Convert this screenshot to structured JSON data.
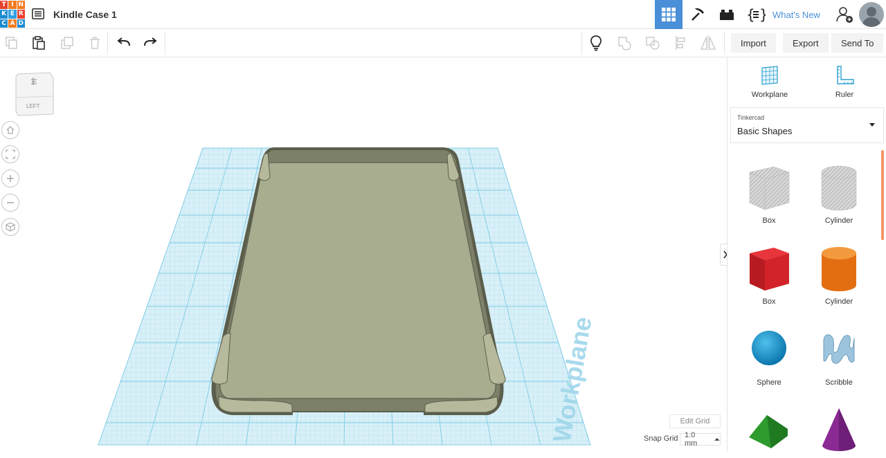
{
  "app": {
    "logo_letters": [
      "T",
      "I",
      "N",
      "K",
      "E",
      "R",
      "C",
      "A",
      "D"
    ],
    "logo_colors": [
      "#e8422f",
      "#f37b21",
      "#f37b21",
      "#1d8bd1",
      "#2f9fe0",
      "#e8422f",
      "#1d8bd1",
      "#f37b21",
      "#1d8bd1"
    ],
    "document_title": "Kindle Case 1",
    "whats_new": "What's New"
  },
  "toolbar": {
    "import_label": "Import",
    "export_label": "Export",
    "send_to_label": "Send To"
  },
  "viewport": {
    "viewcube_face": "LEFT",
    "workplane_text": "Workplane",
    "edit_grid": "Edit Grid",
    "snap_grid_label": "Snap Grid",
    "snap_grid_value": "1.0 mm",
    "grid_color": "#7ecbe6",
    "model_color": "#a9ad8f"
  },
  "panel": {
    "workplane_label": "Workplane",
    "ruler_label": "Ruler",
    "library_source": "Tinkercad",
    "library_name": "Basic Shapes",
    "shapes": [
      {
        "label": "Box",
        "icon": "box-hole-icon"
      },
      {
        "label": "Cylinder",
        "icon": "cylinder-hole-icon"
      },
      {
        "label": "Box",
        "icon": "box-icon"
      },
      {
        "label": "Cylinder",
        "icon": "cylinder-icon"
      },
      {
        "label": "Sphere",
        "icon": "sphere-icon"
      },
      {
        "label": "Scribble",
        "icon": "scribble-icon"
      },
      {
        "label": "",
        "icon": "roof-icon"
      },
      {
        "label": "",
        "icon": "cone-icon"
      }
    ]
  }
}
